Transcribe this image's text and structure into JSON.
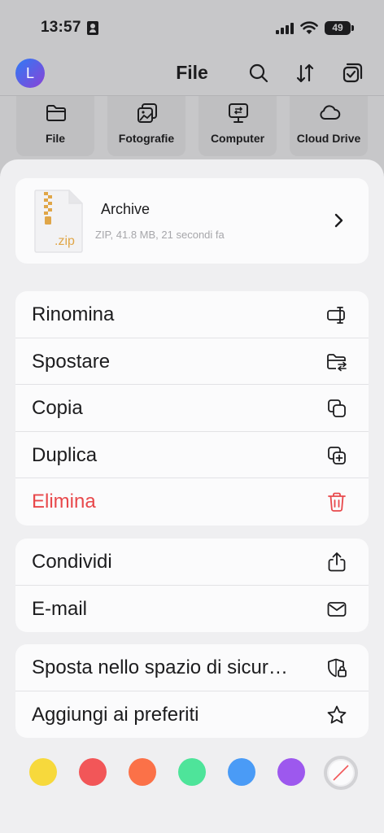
{
  "status": {
    "time": "13:57",
    "battery": "49"
  },
  "header": {
    "avatar_letter": "L",
    "title": "File"
  },
  "categories": [
    {
      "label": "File",
      "icon": "folder-icon"
    },
    {
      "label": "Fotografie",
      "icon": "photos-icon"
    },
    {
      "label": "Computer",
      "icon": "computer-icon"
    },
    {
      "label": "Cloud Drive",
      "icon": "cloud-icon"
    }
  ],
  "file": {
    "name": "Archive",
    "meta": "ZIP, 41.8 MB, 21 secondi fa",
    "ext": ".zip"
  },
  "actions_group1": [
    {
      "label": "Rinomina",
      "icon": "rename-icon"
    },
    {
      "label": "Spostare",
      "icon": "move-folder-icon"
    },
    {
      "label": "Copia",
      "icon": "copy-icon"
    },
    {
      "label": "Duplica",
      "icon": "duplicate-icon"
    },
    {
      "label": "Elimina",
      "icon": "trash-icon"
    }
  ],
  "actions_group2": [
    {
      "label": "Condividi",
      "icon": "share-icon"
    },
    {
      "label": "E-mail",
      "icon": "mail-icon"
    }
  ],
  "actions_group3": [
    {
      "label": "Sposta nello spazio di sicur…",
      "icon": "secure-space-icon"
    },
    {
      "label": "Aggiungi ai preferiti",
      "icon": "star-icon"
    }
  ],
  "color_tags": [
    "#f7d93c",
    "#f25658",
    "#fb7148",
    "#4ee49a",
    "#4a9bf6",
    "#9d58ee"
  ],
  "colors": {
    "danger": "#e8484b",
    "accent_zip": "#e0a648"
  }
}
